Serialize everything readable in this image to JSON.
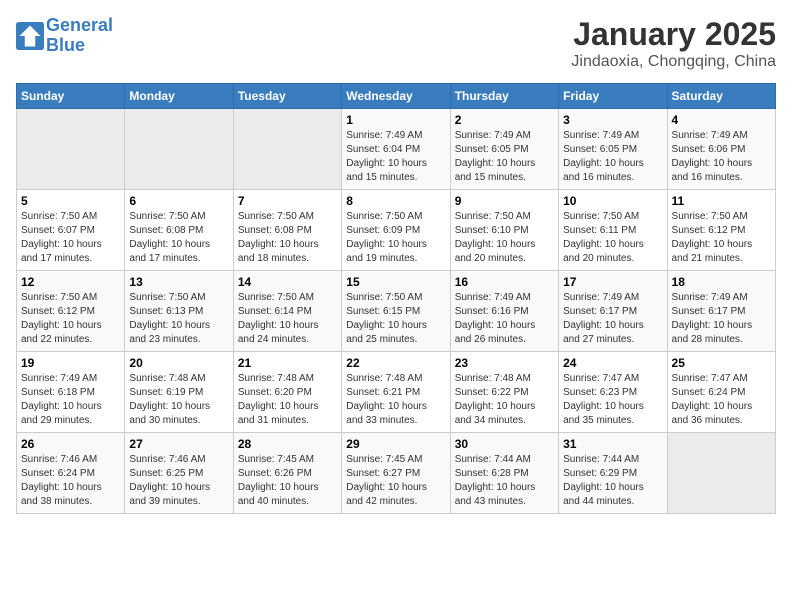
{
  "header": {
    "logo_line1": "General",
    "logo_line2": "Blue",
    "title": "January 2025",
    "subtitle": "Jindaoxia, Chongqing, China"
  },
  "weekdays": [
    "Sunday",
    "Monday",
    "Tuesday",
    "Wednesday",
    "Thursday",
    "Friday",
    "Saturday"
  ],
  "weeks": [
    [
      {
        "day": "",
        "info": ""
      },
      {
        "day": "",
        "info": ""
      },
      {
        "day": "",
        "info": ""
      },
      {
        "day": "1",
        "info": "Sunrise: 7:49 AM\nSunset: 6:04 PM\nDaylight: 10 hours\nand 15 minutes."
      },
      {
        "day": "2",
        "info": "Sunrise: 7:49 AM\nSunset: 6:05 PM\nDaylight: 10 hours\nand 15 minutes."
      },
      {
        "day": "3",
        "info": "Sunrise: 7:49 AM\nSunset: 6:05 PM\nDaylight: 10 hours\nand 16 minutes."
      },
      {
        "day": "4",
        "info": "Sunrise: 7:49 AM\nSunset: 6:06 PM\nDaylight: 10 hours\nand 16 minutes."
      }
    ],
    [
      {
        "day": "5",
        "info": "Sunrise: 7:50 AM\nSunset: 6:07 PM\nDaylight: 10 hours\nand 17 minutes."
      },
      {
        "day": "6",
        "info": "Sunrise: 7:50 AM\nSunset: 6:08 PM\nDaylight: 10 hours\nand 17 minutes."
      },
      {
        "day": "7",
        "info": "Sunrise: 7:50 AM\nSunset: 6:08 PM\nDaylight: 10 hours\nand 18 minutes."
      },
      {
        "day": "8",
        "info": "Sunrise: 7:50 AM\nSunset: 6:09 PM\nDaylight: 10 hours\nand 19 minutes."
      },
      {
        "day": "9",
        "info": "Sunrise: 7:50 AM\nSunset: 6:10 PM\nDaylight: 10 hours\nand 20 minutes."
      },
      {
        "day": "10",
        "info": "Sunrise: 7:50 AM\nSunset: 6:11 PM\nDaylight: 10 hours\nand 20 minutes."
      },
      {
        "day": "11",
        "info": "Sunrise: 7:50 AM\nSunset: 6:12 PM\nDaylight: 10 hours\nand 21 minutes."
      }
    ],
    [
      {
        "day": "12",
        "info": "Sunrise: 7:50 AM\nSunset: 6:12 PM\nDaylight: 10 hours\nand 22 minutes."
      },
      {
        "day": "13",
        "info": "Sunrise: 7:50 AM\nSunset: 6:13 PM\nDaylight: 10 hours\nand 23 minutes."
      },
      {
        "day": "14",
        "info": "Sunrise: 7:50 AM\nSunset: 6:14 PM\nDaylight: 10 hours\nand 24 minutes."
      },
      {
        "day": "15",
        "info": "Sunrise: 7:50 AM\nSunset: 6:15 PM\nDaylight: 10 hours\nand 25 minutes."
      },
      {
        "day": "16",
        "info": "Sunrise: 7:49 AM\nSunset: 6:16 PM\nDaylight: 10 hours\nand 26 minutes."
      },
      {
        "day": "17",
        "info": "Sunrise: 7:49 AM\nSunset: 6:17 PM\nDaylight: 10 hours\nand 27 minutes."
      },
      {
        "day": "18",
        "info": "Sunrise: 7:49 AM\nSunset: 6:17 PM\nDaylight: 10 hours\nand 28 minutes."
      }
    ],
    [
      {
        "day": "19",
        "info": "Sunrise: 7:49 AM\nSunset: 6:18 PM\nDaylight: 10 hours\nand 29 minutes."
      },
      {
        "day": "20",
        "info": "Sunrise: 7:48 AM\nSunset: 6:19 PM\nDaylight: 10 hours\nand 30 minutes."
      },
      {
        "day": "21",
        "info": "Sunrise: 7:48 AM\nSunset: 6:20 PM\nDaylight: 10 hours\nand 31 minutes."
      },
      {
        "day": "22",
        "info": "Sunrise: 7:48 AM\nSunset: 6:21 PM\nDaylight: 10 hours\nand 33 minutes."
      },
      {
        "day": "23",
        "info": "Sunrise: 7:48 AM\nSunset: 6:22 PM\nDaylight: 10 hours\nand 34 minutes."
      },
      {
        "day": "24",
        "info": "Sunrise: 7:47 AM\nSunset: 6:23 PM\nDaylight: 10 hours\nand 35 minutes."
      },
      {
        "day": "25",
        "info": "Sunrise: 7:47 AM\nSunset: 6:24 PM\nDaylight: 10 hours\nand 36 minutes."
      }
    ],
    [
      {
        "day": "26",
        "info": "Sunrise: 7:46 AM\nSunset: 6:24 PM\nDaylight: 10 hours\nand 38 minutes."
      },
      {
        "day": "27",
        "info": "Sunrise: 7:46 AM\nSunset: 6:25 PM\nDaylight: 10 hours\nand 39 minutes."
      },
      {
        "day": "28",
        "info": "Sunrise: 7:45 AM\nSunset: 6:26 PM\nDaylight: 10 hours\nand 40 minutes."
      },
      {
        "day": "29",
        "info": "Sunrise: 7:45 AM\nSunset: 6:27 PM\nDaylight: 10 hours\nand 42 minutes."
      },
      {
        "day": "30",
        "info": "Sunrise: 7:44 AM\nSunset: 6:28 PM\nDaylight: 10 hours\nand 43 minutes."
      },
      {
        "day": "31",
        "info": "Sunrise: 7:44 AM\nSunset: 6:29 PM\nDaylight: 10 hours\nand 44 minutes."
      },
      {
        "day": "",
        "info": ""
      }
    ]
  ]
}
